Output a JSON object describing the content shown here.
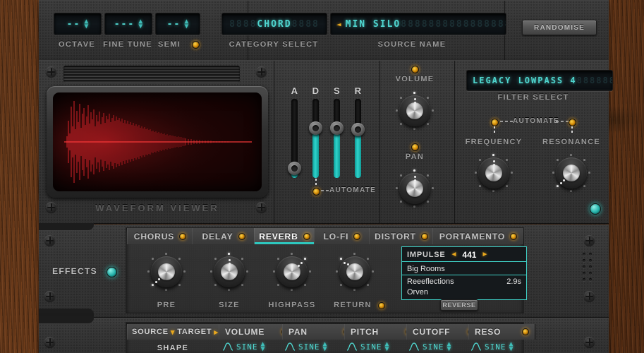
{
  "top_bar": {
    "tune": {
      "octave": {
        "label": "OCTAVE",
        "value": "--"
      },
      "fine_tune": {
        "label": "FINE TUNE",
        "value": "---"
      },
      "semi": {
        "label": "SEMI",
        "value": "--",
        "led": "on"
      }
    },
    "category_select": {
      "label": "CATEGORY SELECT",
      "value": "CHORD"
    },
    "source_name": {
      "label": "SOURCE NAME",
      "value": "MIN SILO",
      "prev_arrow": "◄",
      "next_arrow": "►"
    },
    "randomise_button": "RANDOMISE"
  },
  "waveform": {
    "caption": "WAVEFORM VIEWER"
  },
  "envelope": {
    "sliders": [
      {
        "label": "A",
        "value": 8
      },
      {
        "label": "D",
        "value": 62
      },
      {
        "label": "S",
        "value": 62
      },
      {
        "label": "R",
        "value": 60
      }
    ],
    "automate_label": "AUTOMATE"
  },
  "output": {
    "volume": {
      "label": "VOLUME",
      "angle": 0
    },
    "pan": {
      "label": "PAN",
      "angle": 0
    }
  },
  "filter": {
    "select_label": "FILTER SELECT",
    "select_value": "LEGACY LOWPASS 4",
    "automate_label": "AUTOMATE",
    "frequency": {
      "label": "FREQUENCY",
      "angle": 0
    },
    "resonance": {
      "label": "RESONANCE",
      "angle": -140
    }
  },
  "effects": {
    "label": "EFFECTS",
    "enabled": true,
    "tabs": [
      {
        "label": "CHORUS",
        "active": false
      },
      {
        "label": "DELAY",
        "active": false
      },
      {
        "label": "REVERB",
        "active": true
      },
      {
        "label": "LO-FI",
        "active": false
      },
      {
        "label": "DISTORT",
        "active": false
      },
      {
        "label": "PORTAMENTO",
        "active": false
      }
    ],
    "reverb": {
      "knobs": [
        {
          "label": "PRE",
          "angle": -140,
          "led": false
        },
        {
          "label": "SIZE",
          "angle": 0,
          "led": false
        },
        {
          "label": "HIGHPASS",
          "angle": 62,
          "led": false
        },
        {
          "label": "RETURN",
          "angle": -62,
          "led": true
        }
      ],
      "impulse": {
        "label": "IMPULSE",
        "value": "441",
        "prev_arrow": "◄",
        "next_arrow": "►",
        "category": "Big Rooms",
        "entries": [
          {
            "name": "Reeeflections",
            "length": "2.9s"
          },
          {
            "name": "Orven",
            "length": ""
          }
        ]
      },
      "reverse_button": "REVERSE"
    }
  },
  "mod_matrix": {
    "source_label": "SOURCE",
    "target_label": "TARGET",
    "source_caret": "▾",
    "target_caret": "▸",
    "columns": [
      {
        "label": "VOLUME"
      },
      {
        "label": "PAN"
      },
      {
        "label": "PITCH"
      },
      {
        "label": "CUTOFF"
      },
      {
        "label": "RESO"
      }
    ],
    "shape_row": {
      "label": "SHAPE",
      "values": [
        "SINE",
        "SINE",
        "SINE",
        "SINE",
        "SINE"
      ]
    }
  },
  "colors": {
    "accent_teal": "#2ec8bf",
    "led_amber": "#e9a81e",
    "lcd_text": "#4fd6cf",
    "waveform_red": "#d4232a",
    "wood": "#7a441f"
  }
}
